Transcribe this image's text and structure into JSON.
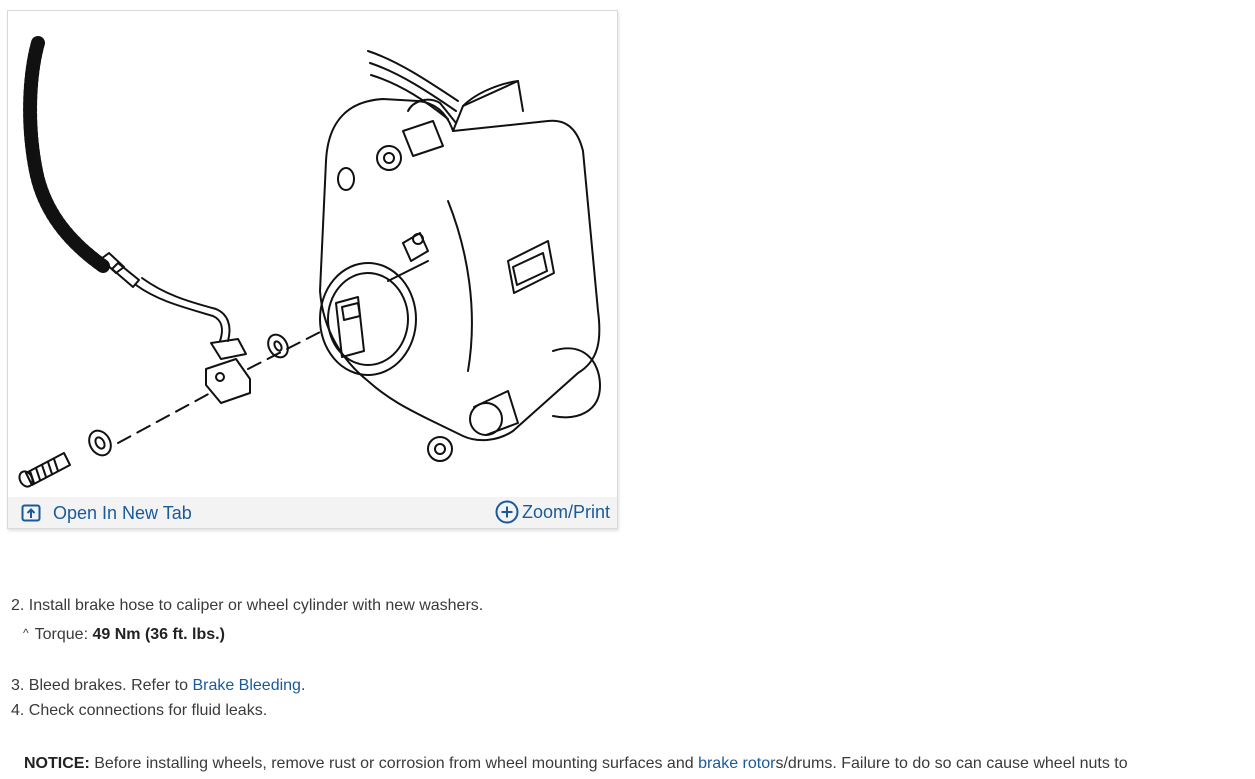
{
  "figure": {
    "open_tab_label": "Open In New Tab",
    "zoom_label": "Zoom/Print",
    "open_tab_icon": "open-new-tab-icon",
    "zoom_icon": "plus-circle-icon",
    "link_color": "#1a5a9c"
  },
  "steps": {
    "step2": "2. Install brake hose to caliper or wheel cylinder with new washers.",
    "torque_caret": "^",
    "torque_label": "Torque:",
    "torque_value": "49 Nm (36 ft. lbs.)",
    "step3_prefix": "3. Bleed brakes. Refer to",
    "step3_link": "Brake Bleeding",
    "step3_suffix": ".",
    "step4": "4. Check connections for fluid leaks."
  },
  "notice": {
    "label": "NOTICE:",
    "text_before": "Before installing wheels, remove rust or corrosion from wheel mounting surfaces and",
    "link": "brake rotor",
    "text_after": "s/drums. Failure to do so can cause wheel nuts to"
  }
}
